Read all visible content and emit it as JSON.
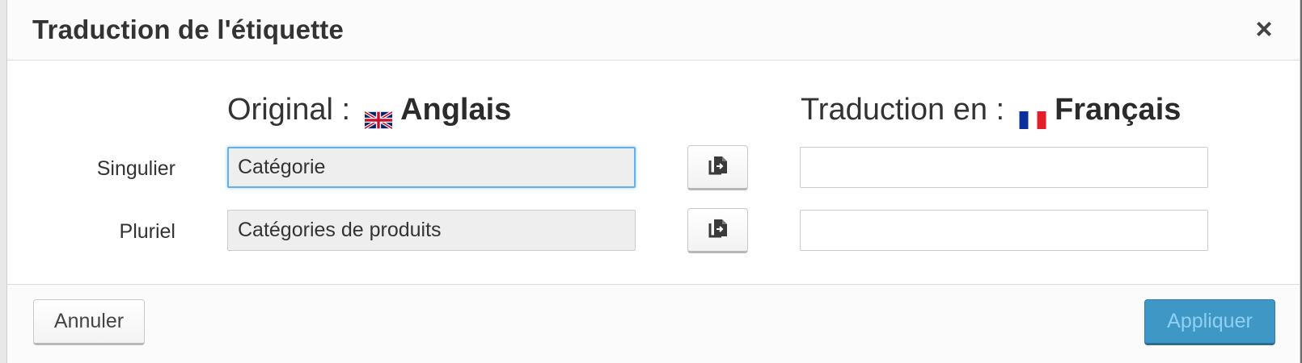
{
  "dialog": {
    "title": "Traduction de l'étiquette",
    "close_glyph": "×"
  },
  "columns": {
    "original": {
      "prefix": "Original :",
      "language": "Anglais",
      "flag_icon": "uk-flag-icon"
    },
    "translation": {
      "prefix": "Traduction en :",
      "language": "Français",
      "flag_icon": "france-flag-icon"
    }
  },
  "rows": [
    {
      "label": "Singulier",
      "original_value": "Catégorie",
      "translation_value": "",
      "copy_icon": "copy-icon"
    },
    {
      "label": "Pluriel",
      "original_value": "Catégories de produits",
      "translation_value": "",
      "copy_icon": "copy-icon"
    }
  ],
  "footer": {
    "cancel_label": "Annuler",
    "apply_label": "Appliquer"
  },
  "colors": {
    "apply_button": "#3e97c5",
    "focus_border": "#66afe9",
    "readonly_bg": "#eeeeee"
  }
}
